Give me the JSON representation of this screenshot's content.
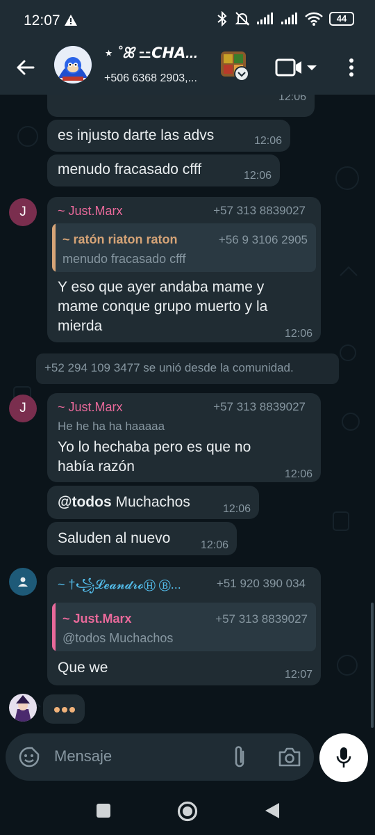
{
  "status_bar": {
    "time": "12:07",
    "battery": "44"
  },
  "header": {
    "title": "⋆ ˚ꕤ ⚍𝘾𝙃𝘼...",
    "subtitle": "+506 6368 2903,..."
  },
  "messages": {
    "m0": {
      "time": "12:06"
    },
    "m1": {
      "text": "es injusto darte las advs",
      "time": "12:06"
    },
    "m2": {
      "text": "menudo fracasado cfff",
      "time": "12:06"
    },
    "m3": {
      "avatar_letter": "J",
      "sender": "~ Just.Marx",
      "phone": "+57 313 8839027",
      "quote_name": "~ ratón riaton raton",
      "quote_phone": "+56 9 3106 2905",
      "quote_text": "menudo fracasado cfff",
      "lines": [
        "Y eso que ayer andaba mame y",
        "mame conque grupo muerto y la",
        "mierda"
      ],
      "time": "12:06"
    },
    "system": "+52 294 109 3477 se unió desde la comunidad.",
    "m4": {
      "avatar_letter": "J",
      "sender": "~ Just.Marx",
      "phone": "+57 313 8839027",
      "subtitle": "He he ha ha haaaaa",
      "lines": [
        "Yo lo hechaba pero es que no",
        "había razón"
      ],
      "time": "12:06"
    },
    "m5": {
      "mention": "@todos",
      "text": " Muchachos",
      "time": "12:06"
    },
    "m6": {
      "text": "Saluden al nuevo",
      "time": "12:06"
    },
    "m7": {
      "sender": "~ †꧁𝓛𝓮𝓪𝓷𝓭𝓻𝓸Ⓗ Ⓑ...",
      "phone": "+51 920 390 034",
      "quote_name": "~ Just.Marx",
      "quote_phone": "+57 313 8839027",
      "quote_text": "@todos Muchachos",
      "text": "Que we",
      "time": "12:07"
    }
  },
  "input": {
    "placeholder": "Mensaje"
  },
  "colors": {
    "just_marx": "#e8699a",
    "leandro": "#53bdeb",
    "raton": "#d6a477",
    "bubble": "#202c33",
    "background": "#0b141a"
  }
}
